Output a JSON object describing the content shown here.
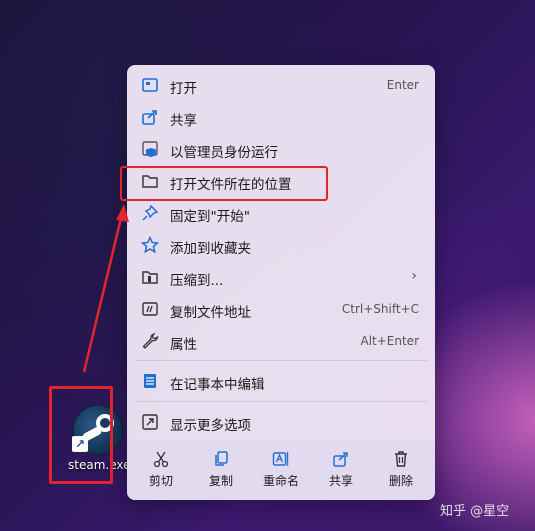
{
  "desktop_icon": {
    "label": "steam.exe",
    "icon": "steam-icon"
  },
  "context_menu": {
    "items": [
      {
        "label": "打开",
        "shortcut": "Enter",
        "icon": "open-icon"
      },
      {
        "label": "共享",
        "shortcut": "",
        "icon": "share-icon"
      },
      {
        "label": "以管理员身份运行",
        "shortcut": "",
        "icon": "shield-icon"
      },
      {
        "label": "打开文件所在的位置",
        "shortcut": "",
        "icon": "folder-icon"
      },
      {
        "label": "固定到\"开始\"",
        "shortcut": "",
        "icon": "pin-icon"
      },
      {
        "label": "添加到收藏夹",
        "shortcut": "",
        "icon": "star-icon"
      },
      {
        "label": "压缩到...",
        "shortcut": "",
        "icon": "archive-folder-icon",
        "submenu_glyph": "›"
      },
      {
        "label": "复制文件地址",
        "shortcut": "Ctrl+Shift+C",
        "icon": "path-icon"
      },
      {
        "label": "属性",
        "shortcut": "Alt+Enter",
        "icon": "wrench-icon"
      },
      {
        "label": "在记事本中编辑",
        "shortcut": "",
        "icon": "notepad-icon"
      },
      {
        "label": "显示更多选项",
        "shortcut": "",
        "icon": "more-options-icon"
      }
    ],
    "actions": [
      {
        "label": "剪切",
        "icon": "scissors-icon"
      },
      {
        "label": "复制",
        "icon": "copy-icon"
      },
      {
        "label": "重命名",
        "icon": "rename-icon"
      },
      {
        "label": "共享",
        "icon": "share-icon"
      },
      {
        "label": "删除",
        "icon": "trash-icon"
      }
    ]
  },
  "annotation_color": "#e3252c",
  "accent_color": "#1f6fd6",
  "watermark": "知乎 @星空"
}
